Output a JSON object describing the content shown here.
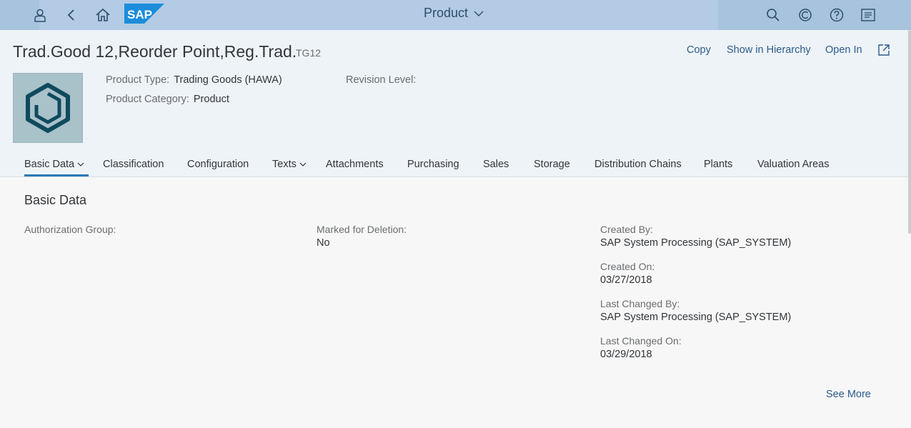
{
  "shell": {
    "title": "Product",
    "icons": [
      "user-icon",
      "back-icon",
      "home-icon",
      "sap-logo",
      "search-icon",
      "copilot-icon",
      "help-icon",
      "notifications-icon"
    ],
    "logo_text": "SAP"
  },
  "header": {
    "title": "Trad.Good 12,Reorder Point,Reg.Trad.",
    "subtitle": "TG12",
    "actions": {
      "copy": "Copy",
      "show_in_hierarchy": "Show in Hierarchy",
      "open_in": "Open In"
    },
    "attributes": {
      "product_type_label": "Product Type:",
      "product_type_value": "Trading Goods (HAWA)",
      "product_category_label": "Product Category:",
      "product_category_value": "Product",
      "revision_level_label": "Revision Level:"
    }
  },
  "tabs": [
    {
      "label": "Basic Data"
    },
    {
      "label": "Classification"
    },
    {
      "label": "Configuration"
    },
    {
      "label": "Texts"
    },
    {
      "label": "Attachments"
    },
    {
      "label": "Purchasing"
    },
    {
      "label": "Sales"
    },
    {
      "label": "Storage"
    },
    {
      "label": "Distribution Chains"
    },
    {
      "label": "Plants"
    },
    {
      "label": "Valuation Areas"
    }
  ],
  "section": {
    "title": "Basic Data",
    "authorization_group_label": "Authorization Group:",
    "marked_for_deletion_label": "Marked for Deletion:",
    "marked_for_deletion_value": "No",
    "created_by_label": "Created By:",
    "created_by_value": "SAP System Processing (SAP_SYSTEM)",
    "created_on_label": "Created On:",
    "created_on_value": "03/27/2018",
    "last_changed_by_label": "Last Changed By:",
    "last_changed_by_value": "SAP System Processing (SAP_SYSTEM)",
    "last_changed_on_label": "Last Changed On:",
    "last_changed_on_value": "03/29/2018",
    "see_more": "See More"
  },
  "colors": {
    "shell_bg": "#a8c3de",
    "header_bg": "#eef3f8",
    "link": "#2b5b8a",
    "tab_active": "#2b7ab8",
    "tile_bg": "#a9c1c9",
    "icon_dark": "#0e4a5e"
  }
}
